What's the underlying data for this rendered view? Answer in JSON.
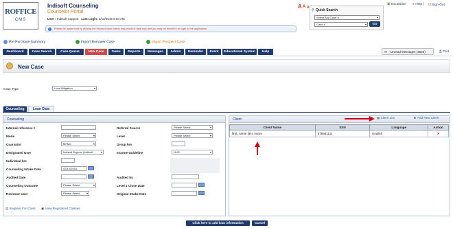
{
  "logo": {
    "brand": "ROFFICE",
    "sub": "CMS"
  },
  "header": {
    "company": "Indisoft Counseling",
    "portal": "Counselor Portal",
    "user_label": "User :",
    "user_value": "Indisoft Support",
    "last_login_label": "Last Login:",
    "last_login_value": "2/12/2015 9:03 AM",
    "notice": "Please be aware that by clicking the browser back button may result in data loss and you may be forced to re-login to the application."
  },
  "font_controls": {
    "a_large": "A",
    "a_medium": "A",
    "a_small": "A"
  },
  "quick_search": {
    "title": "Quick Search",
    "case_select": "Select Any Case #",
    "field_select": "Case #",
    "go_label": "GO"
  },
  "top_links": {
    "escalation": "Escalation",
    "help": "Help",
    "sign_out": "Sign Out"
  },
  "quick_links": {
    "pre_purchase": "Pre Purchase Summary",
    "import_borrower": "Import Borrower Case",
    "import_prospect": "Import Prospect Case"
  },
  "nav": [
    "Dashboard",
    "Case Search",
    "Case Queue",
    "New Case",
    "Tasks",
    "Reports",
    "Messages",
    "Admin",
    "Reminder",
    "Event",
    "Educational System",
    "Help"
  ],
  "nav_active": "New Case",
  "unread": "Unread Messages (3625)",
  "print": "Print",
  "page_title": "New Case",
  "case_type": {
    "label": "Case Type",
    "value": "Loss Mitigation"
  },
  "tabs": [
    "Counseling",
    "Loan Data"
  ],
  "counseling": {
    "heading": "Counseling",
    "left_fields": [
      {
        "label": "Internal reference #",
        "value": ""
      },
      {
        "label": "Mode",
        "value": "Please Select"
      },
      {
        "label": "Guarantor",
        "value": "MFMC"
      },
      {
        "label": "Designated User",
        "value": "Indisoft Support (Indisoft"
      },
      {
        "label": "Individual hrs",
        "value": ""
      },
      {
        "label": "Counseling Intake Date",
        "value": "02/12/2015"
      },
      {
        "label": "Audited Date",
        "value": ""
      },
      {
        "label": "Counseling Outcome",
        "value": "Please Select"
      },
      {
        "label": "Reviewer User",
        "value": "Please Select"
      }
    ],
    "right_fields": [
      {
        "label": "Referral Source",
        "value": "Please Select"
      },
      {
        "label": "Level",
        "value": "Please Select"
      },
      {
        "label": "Group hrs",
        "value": ""
      },
      {
        "label": "Income Guideline",
        "value": "HUD"
      },
      {
        "label": "Audited by",
        "value": ""
      },
      {
        "label": "Level 1 Close Date",
        "value": ""
      },
      {
        "label": "Original Intake Date",
        "value": ""
      }
    ],
    "register_for_class": "Register For Class",
    "view_registered": "View Registered Classes"
  },
  "client": {
    "heading": "Client",
    "client_list": "Client List",
    "add_new": "Add New Client",
    "columns": [
      "Client Name",
      "SSN",
      "Language",
      "Action"
    ],
    "rows": [
      {
        "name": "first_name last_name",
        "ssn": "578941111",
        "language": "English",
        "action": "✕"
      }
    ]
  },
  "buttons": {
    "add_loan": "Click here to add loan information",
    "cancel": "Cancel"
  },
  "colors": {
    "nav": "#1f3a6b",
    "active_nav": "#c94b4b",
    "accent_orange": "#d9721e",
    "annotation_red": "#d0021b"
  }
}
